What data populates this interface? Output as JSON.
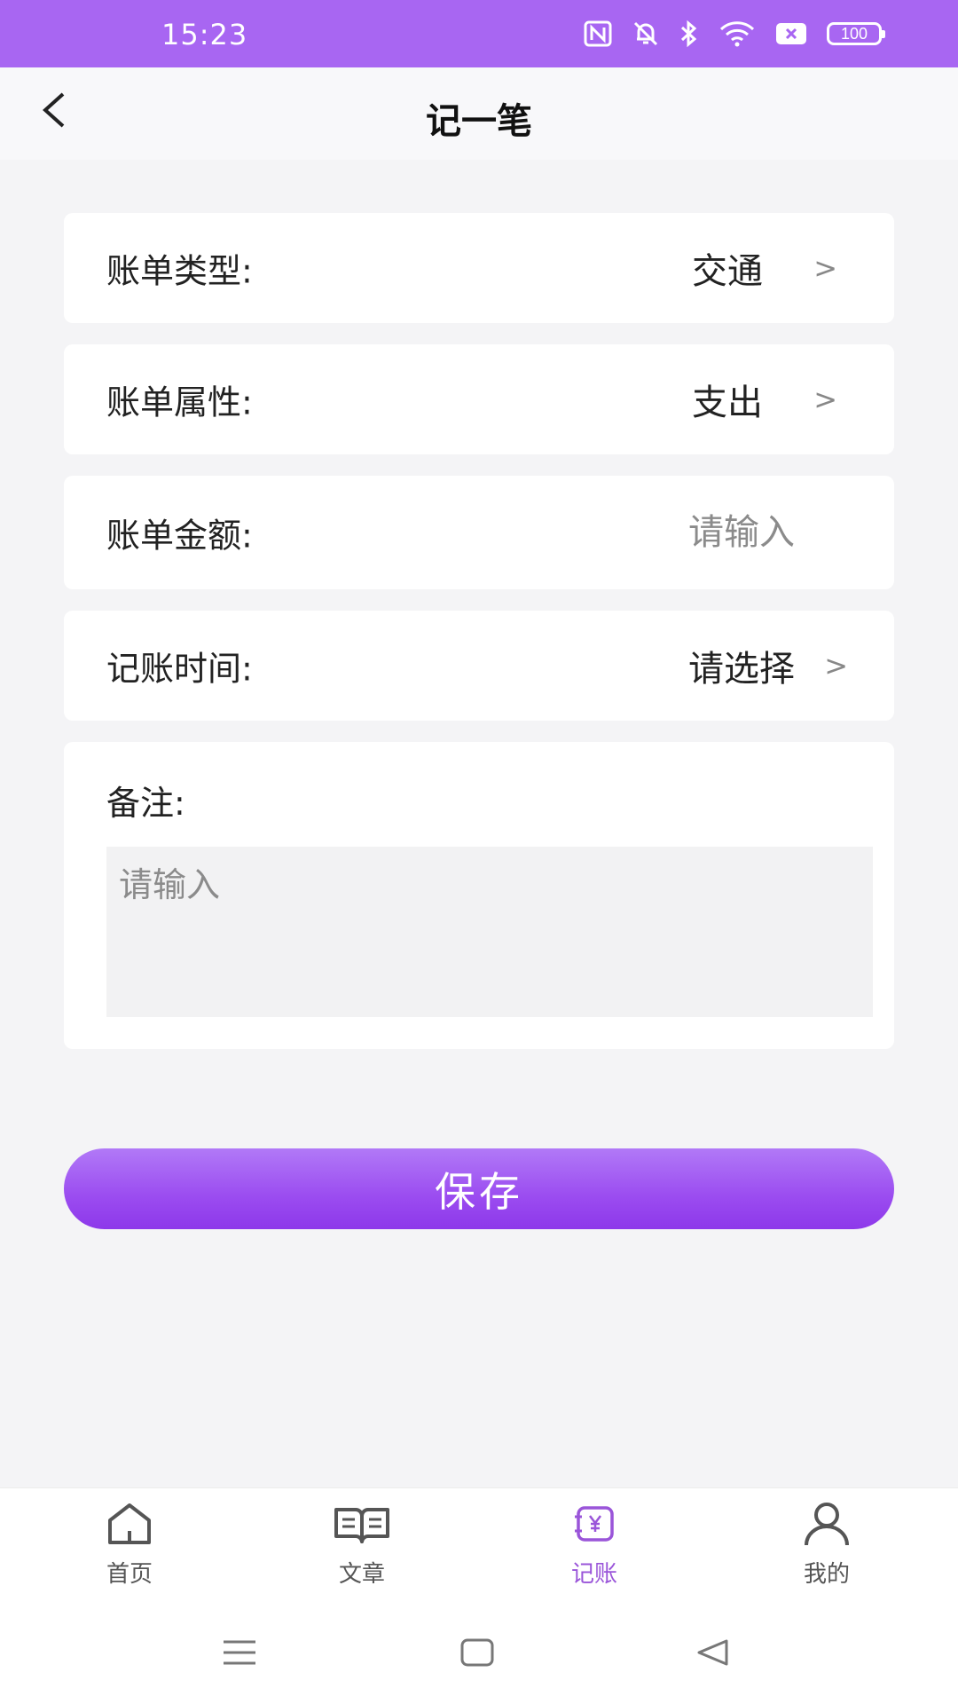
{
  "status_bar": {
    "time": "15:23",
    "battery": "100",
    "icons": [
      "nfc-icon",
      "bell-muted-icon",
      "bluetooth-icon",
      "wifi-icon",
      "sim-x-icon",
      "battery-icon"
    ]
  },
  "header": {
    "title": "记一笔",
    "back_icon": "chevron-left-icon"
  },
  "form": {
    "bill_type": {
      "label": "账单类型:",
      "value": "交通",
      "chevron": ">"
    },
    "bill_attribute": {
      "label": "账单属性:",
      "value": "支出",
      "chevron": ">"
    },
    "bill_amount": {
      "label": "账单金额:",
      "value": "",
      "placeholder": "请输入"
    },
    "bill_time": {
      "label": "记账时间:",
      "value": "请选择",
      "chevron": ">"
    },
    "note": {
      "label": "备注:",
      "value": "",
      "placeholder": "请输入"
    }
  },
  "save_button": {
    "label": "保存"
  },
  "bottom_nav": {
    "items": [
      {
        "label": "首页",
        "icon": "home-icon",
        "active": false
      },
      {
        "label": "文章",
        "icon": "book-icon",
        "active": false
      },
      {
        "label": "记账",
        "icon": "ledger-yen-icon",
        "active": true
      },
      {
        "label": "我的",
        "icon": "user-icon",
        "active": false
      }
    ]
  },
  "system_nav": {
    "icons": [
      "menu-icon",
      "home-square-icon",
      "back-triangle-icon"
    ]
  },
  "colors": {
    "accent": "#a866f2",
    "button_gradient_top": "#b179f7",
    "button_gradient_bottom": "#8d38ea",
    "active_nav": "#9a55d9",
    "background": "#f4f4f6"
  }
}
